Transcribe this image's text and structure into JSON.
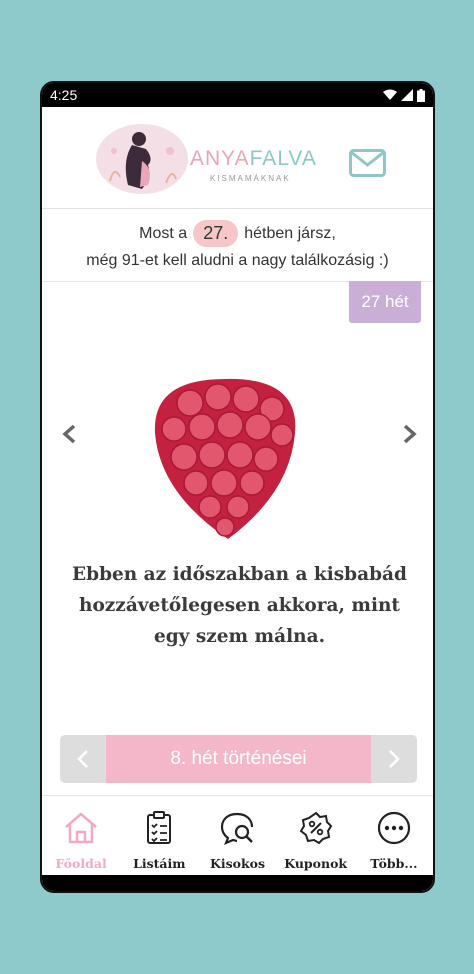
{
  "status": {
    "time": "4:25"
  },
  "logo": {
    "part1": "ANYA",
    "part2": "FALVA",
    "subtitle": "KISMAMÁKNAK"
  },
  "info": {
    "prefix": "Most a",
    "week": "27.",
    "suffix": "hétben jársz,",
    "line2": "még 91-et kell aludni a nagy találkozásig :)"
  },
  "week_badge": "27 hét",
  "description": "Ebben az időszakban a kisbabád hozzávetőlegesen akkora, mint egy szem málna.",
  "week_events": {
    "label": "8. hét történései"
  },
  "tabs": [
    {
      "label": "Főoldal",
      "icon": "home-icon",
      "active": true
    },
    {
      "label": "Listáim",
      "icon": "checklist-icon"
    },
    {
      "label": "Kisokos",
      "icon": "chat-search-icon"
    },
    {
      "label": "Kuponok",
      "icon": "coupon-icon"
    },
    {
      "label": "Több...",
      "icon": "more-icon"
    }
  ],
  "colors": {
    "pink": "#f4b7c9",
    "teal": "#8cc8c7",
    "purple": "#cbaed5",
    "bg": "#8ecacb"
  }
}
